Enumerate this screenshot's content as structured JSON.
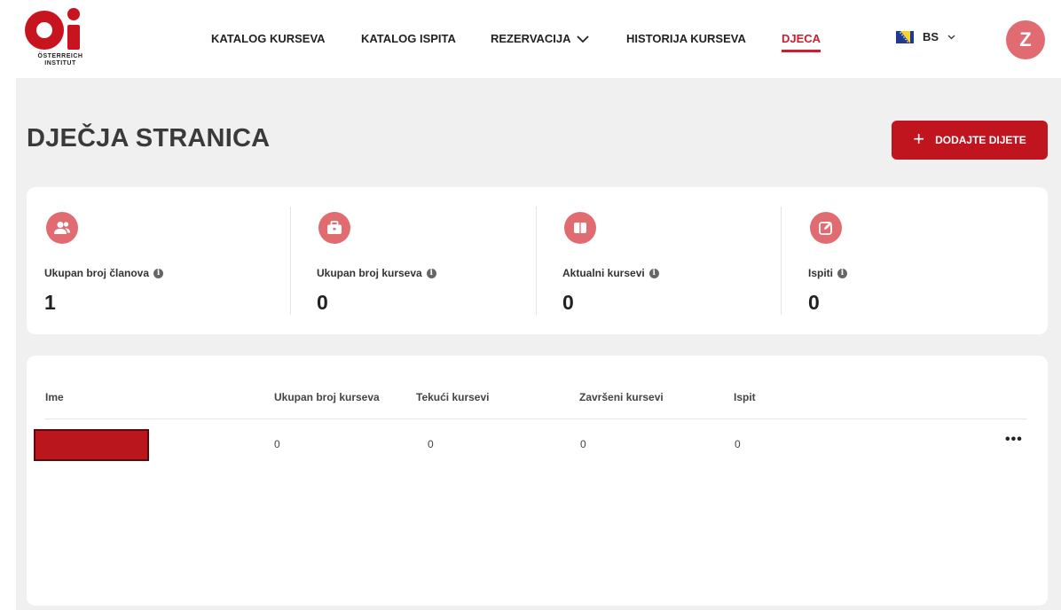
{
  "header": {
    "logo_text": "ÖSTERREICH\nINSTITUT",
    "nav": [
      {
        "label": "KATALOG KURSEVA"
      },
      {
        "label": "KATALOG ISPITA"
      },
      {
        "label": "REZERVACIJA"
      },
      {
        "label": "HISTORIJA KURSEVA"
      },
      {
        "label": "DJECA"
      }
    ],
    "active_nav": "DJECA",
    "language": "BS",
    "avatar_initial": "Z"
  },
  "page": {
    "title": "DJEČJA STRANICA",
    "add_button_label": "DODAJTE DIJETE"
  },
  "stats": [
    {
      "label": "Ukupan broj članova",
      "value": "1",
      "icon": "users-icon"
    },
    {
      "label": "Ukupan broj kurseva",
      "value": "0",
      "icon": "briefcase-icon"
    },
    {
      "label": "Aktualni kursevi",
      "value": "0",
      "icon": "book-icon"
    },
    {
      "label": "Ispiti",
      "value": "0",
      "icon": "edit-icon"
    }
  ],
  "table": {
    "columns": [
      "Ime",
      "Ukupan broj kurseva",
      "Tekući kursevi",
      "Završeni kursevi",
      "Ispit"
    ],
    "rows": [
      {
        "name": "",
        "total": "0",
        "current": "0",
        "finished": "0",
        "exam": "0"
      }
    ]
  },
  "colors": {
    "accent": "#c8202f",
    "icon_bg": "#e06c72",
    "button": "#c0141f"
  }
}
